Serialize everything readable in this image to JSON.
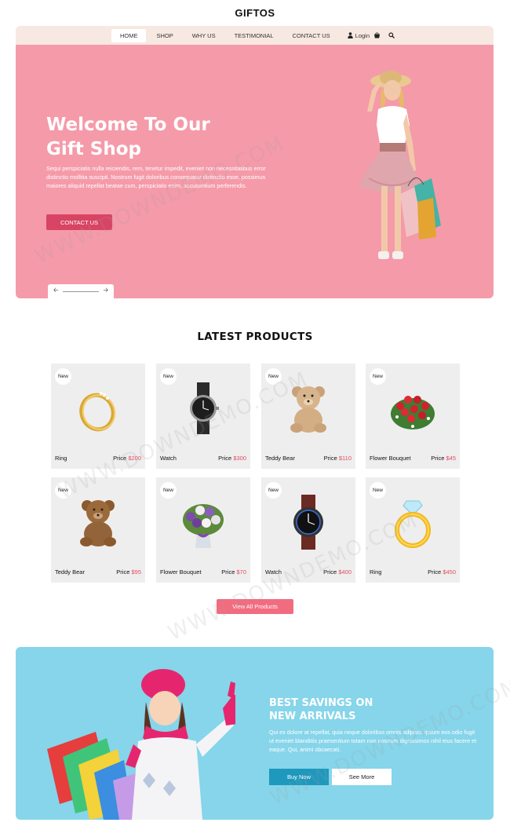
{
  "brand": "GIFTOS",
  "nav": {
    "items": [
      "HOME",
      "SHOP",
      "WHY US",
      "TESTIMONIAL",
      "CONTACT US"
    ],
    "login": "Login",
    "icons": [
      "user-icon",
      "cart-icon",
      "search-icon"
    ]
  },
  "hero": {
    "title_line1": "Welcome To Our",
    "title_line2": "Gift Shop",
    "text": "Sequi perspiciatis nulla reiciendis, rem, tenetur impedit, eveniet non necessitatibus error distinctio mollitia suscipit. Nostrum fugit doloribus consequatur distinctio esse, possimus maiores aliquid repellat beatae cum, perspiciatis enim, accusantium perferendis.",
    "button": "CONTACT US",
    "colors": {
      "background": "#f59aa9",
      "button": "#d84463"
    }
  },
  "latest": {
    "title": "LATEST PRODUCTS",
    "badge": "New",
    "price_label": "Price",
    "products": [
      {
        "name": "Ring",
        "price": "$200",
        "icon": "ring-icon"
      },
      {
        "name": "Watch",
        "price": "$300",
        "icon": "watch-icon"
      },
      {
        "name": "Teddy Bear",
        "price": "$110",
        "icon": "teddy-bear-icon"
      },
      {
        "name": "Flower Bouquet",
        "price": "$45",
        "icon": "flower-bouquet-icon"
      },
      {
        "name": "Teddy Bear",
        "price": "$95",
        "icon": "teddy-bear-icon"
      },
      {
        "name": "Flower Bouquet",
        "price": "$70",
        "icon": "flower-bouquet-icon"
      },
      {
        "name": "Watch",
        "price": "$400",
        "icon": "watch-icon"
      },
      {
        "name": "Ring",
        "price": "$450",
        "icon": "ring-icon"
      }
    ],
    "view_all": "View All Products"
  },
  "promo": {
    "title_line1": "BEST SAVINGS ON",
    "title_line2": "NEW ARRIVALS",
    "text": "Qui ex dolore at repellat, quia neque doloribus omnis adipisci, ipsum eos odio fugit ut eveniet blanditiis praesentium totam non nostrum dignissimos nihil eius facere et eaque. Qui, animi obcaecati.",
    "buy_now": "Buy Now",
    "see_more": "See More",
    "colors": {
      "background": "#86d5ea",
      "buy_button": "#1f98bd"
    }
  },
  "watermark": "WWW.DOWNDEMO.COM"
}
